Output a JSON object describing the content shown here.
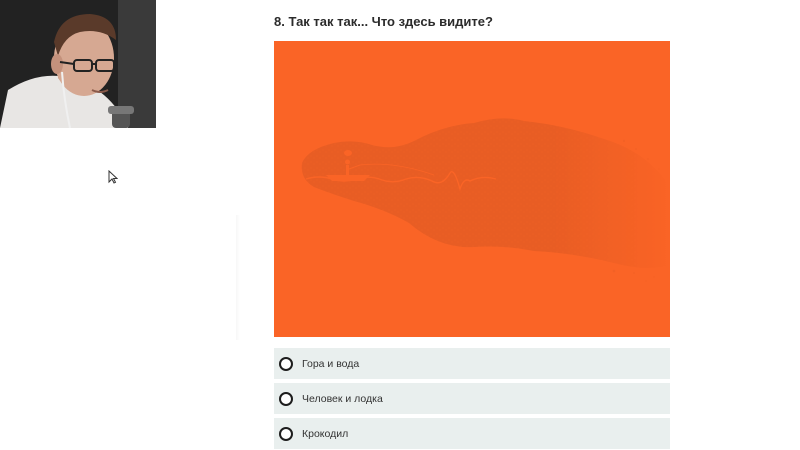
{
  "question": {
    "text": "8. Так так так... Что здесь видите?"
  },
  "illustration": {
    "background_color": "#fa6426",
    "subject_color": "#1c1210",
    "description_icon": "crocodile-head-with-boat-icon"
  },
  "options": [
    {
      "label": "Гора и вода"
    },
    {
      "label": "Человек и лодка"
    },
    {
      "label": "Крокодил"
    }
  ],
  "webcam": {
    "icon": "webcam-person-icon"
  },
  "cursor": {
    "icon": "mouse-pointer-icon"
  }
}
